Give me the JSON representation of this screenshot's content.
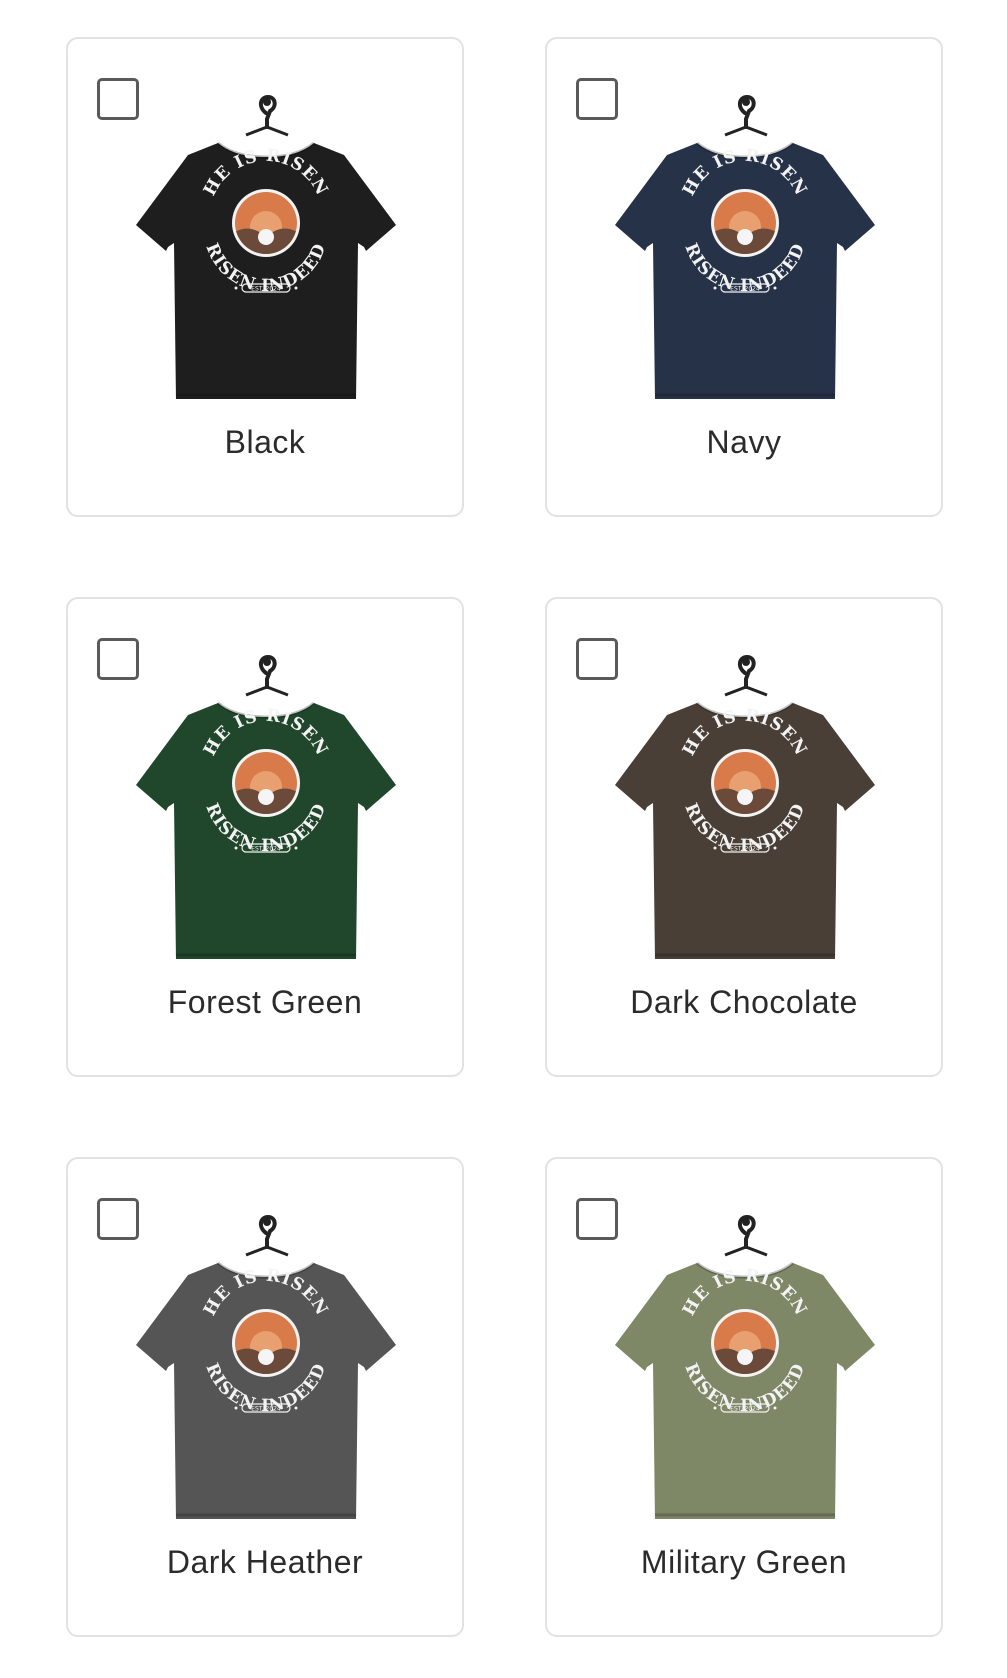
{
  "design": {
    "arc_top": "HE IS RISEN",
    "arc_bottom": "RISEN INDEED",
    "ribbon": "EST. 2024",
    "sun_color": "#d87a4a",
    "ground_color": "#6b4a3a"
  },
  "options": [
    {
      "name": "Black",
      "color": "#1e1e1e",
      "checked": false
    },
    {
      "name": "Navy",
      "color": "#263247",
      "checked": false
    },
    {
      "name": "Forest Green",
      "color": "#20472b",
      "checked": false
    },
    {
      "name": "Dark Chocolate",
      "color": "#4a3f37",
      "checked": false
    },
    {
      "name": "Dark Heather",
      "color": "#555555",
      "checked": false
    },
    {
      "name": "Military Green",
      "color": "#7e8766",
      "checked": false
    }
  ]
}
